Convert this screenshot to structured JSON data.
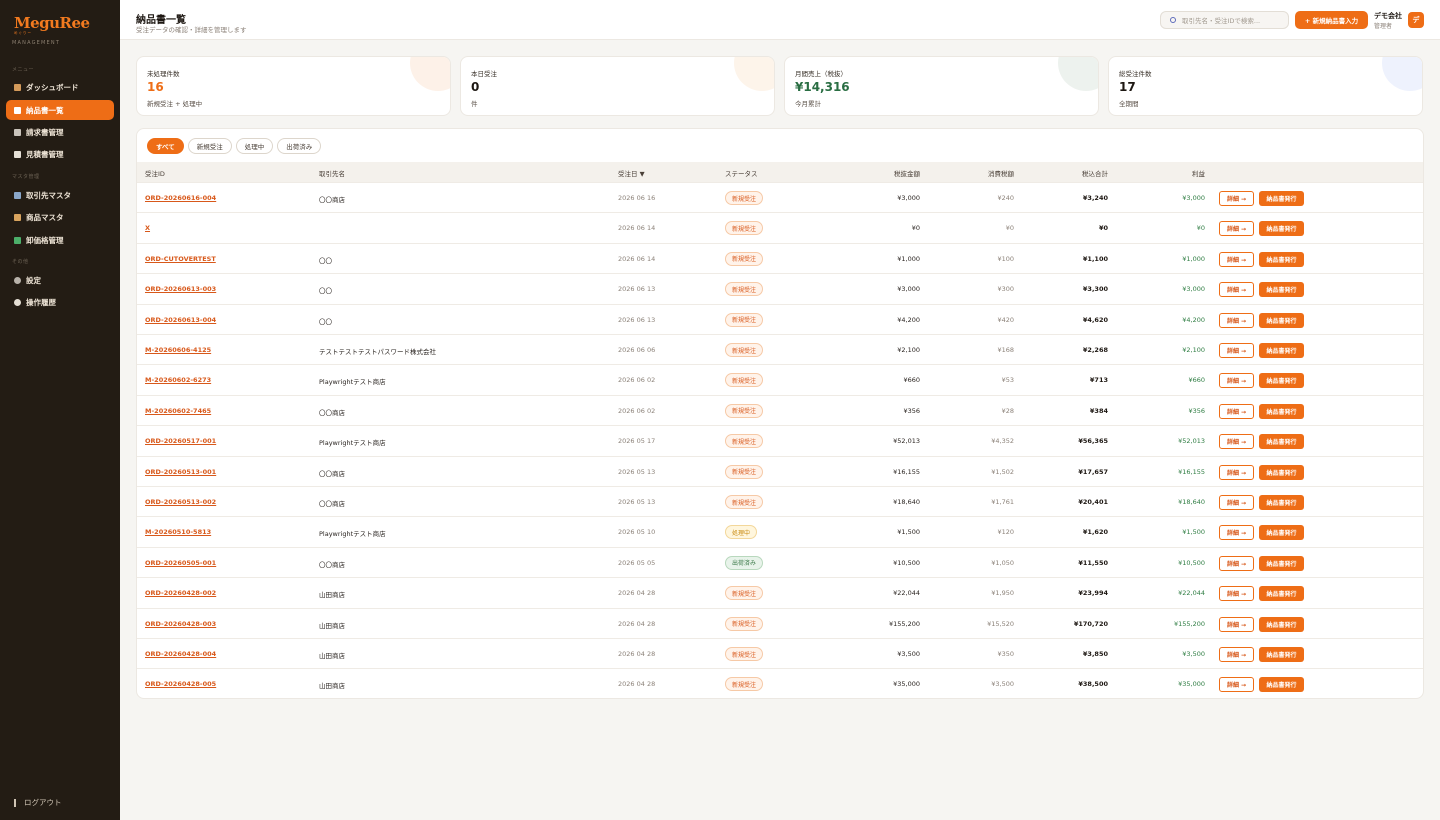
{
  "app": {
    "logo_main": "MeguRee",
    "logo_tagline": "めぐりー",
    "logo_sub": "MANAGEMENT"
  },
  "sidebar": {
    "sections": [
      "メニュー",
      "マスタ管理",
      "その他"
    ],
    "items": [
      {
        "label": "ダッシュボード",
        "icon": "house-icon",
        "active": false
      },
      {
        "label": "納品書一覧",
        "icon": "document-icon",
        "active": true
      },
      {
        "label": "請求書管理",
        "icon": "invoice-icon",
        "active": false
      },
      {
        "label": "見積書管理",
        "icon": "quote-icon",
        "active": false
      },
      {
        "label": "取引先マスタ",
        "icon": "building-icon",
        "active": false
      },
      {
        "label": "商品マスタ",
        "icon": "box-icon",
        "active": false
      },
      {
        "label": "卸価格管理",
        "icon": "price-icon",
        "active": false
      },
      {
        "label": "設定",
        "icon": "gear-icon",
        "active": false
      },
      {
        "label": "操作履歴",
        "icon": "clock-icon",
        "active": false
      }
    ],
    "logout_label": "ログアウト"
  },
  "header": {
    "title": "納品書一覧",
    "subtitle": "受注データの確認・詳細を管理します",
    "search_placeholder": "取引先名・受注IDで検索...",
    "new_button": "+ 新規納品書入力",
    "user_name": "デモ会社",
    "user_role": "管理者",
    "avatar_initial": "デ"
  },
  "stats": [
    {
      "label": "未処理件数",
      "value": "16",
      "sub": "新規受注 + 処理中",
      "color": "#ee6d16",
      "deco": "#fdf1e8"
    },
    {
      "label": "本日受注",
      "value": "0",
      "sub": "件",
      "color": "#1d1712",
      "deco": "#fdf4ea"
    },
    {
      "label": "月間売上（税抜）",
      "value": "¥14,316",
      "sub": "今月累計",
      "color": "#2a6e43",
      "deco": "#edf2ee"
    },
    {
      "label": "総受注件数",
      "value": "17",
      "sub": "全期間",
      "color": "#1d1712",
      "deco": "#eef2fd"
    }
  ],
  "filters": [
    "すべて",
    "新規受注",
    "処理中",
    "出荷済み"
  ],
  "active_filter": "すべて",
  "table": {
    "headers": {
      "id": "受注ID",
      "client": "取引先名",
      "date": "受注日 ▼",
      "status": "ステータス",
      "subtotal": "税抜金額",
      "tax": "消費税額",
      "total": "税込合計",
      "profit": "利益"
    },
    "detail_label": "詳細 →",
    "issue_label": "納品書発行",
    "rows": [
      {
        "id": "ORD-20260616-004",
        "client": "〇〇商店",
        "date": "2026 06 16",
        "status": "新規受注",
        "status_type": "new",
        "subtotal": "¥3,000",
        "tax": "¥240",
        "total": "¥3,240",
        "profit": "¥3,000"
      },
      {
        "id": "X",
        "client": "",
        "date": "2026 06 14",
        "status": "新規受注",
        "status_type": "new",
        "subtotal": "¥0",
        "tax": "¥0",
        "total": "¥0",
        "profit": "¥0"
      },
      {
        "id": "ORD-CUTOVERTEST",
        "client": "〇〇",
        "date": "2026 06 14",
        "status": "新規受注",
        "status_type": "new",
        "subtotal": "¥1,000",
        "tax": "¥100",
        "total": "¥1,100",
        "profit": "¥1,000"
      },
      {
        "id": "ORD-20260613-003",
        "client": "〇〇",
        "date": "2026 06 13",
        "status": "新規受注",
        "status_type": "new",
        "subtotal": "¥3,000",
        "tax": "¥300",
        "total": "¥3,300",
        "profit": "¥3,000"
      },
      {
        "id": "ORD-20260613-004",
        "client": "〇〇",
        "date": "2026 06 13",
        "status": "新規受注",
        "status_type": "new",
        "subtotal": "¥4,200",
        "tax": "¥420",
        "total": "¥4,620",
        "profit": "¥4,200"
      },
      {
        "id": "M-20260606-4125",
        "client": "テストテストテストパスワード株式会社",
        "date": "2026 06 06",
        "status": "新規受注",
        "status_type": "new",
        "subtotal": "¥2,100",
        "tax": "¥168",
        "total": "¥2,268",
        "profit": "¥2,100"
      },
      {
        "id": "M-20260602-6273",
        "client": "Playwrightテスト商店",
        "date": "2026 06 02",
        "status": "新規受注",
        "status_type": "new",
        "subtotal": "¥660",
        "tax": "¥53",
        "total": "¥713",
        "profit": "¥660"
      },
      {
        "id": "M-20260602-7465",
        "client": "〇〇商店",
        "date": "2026 06 02",
        "status": "新規受注",
        "status_type": "new",
        "subtotal": "¥356",
        "tax": "¥28",
        "total": "¥384",
        "profit": "¥356"
      },
      {
        "id": "ORD-20260517-001",
        "client": "Playwrightテスト商店",
        "date": "2026 05 17",
        "status": "新規受注",
        "status_type": "new",
        "subtotal": "¥52,013",
        "tax": "¥4,352",
        "total": "¥56,365",
        "profit": "¥52,013"
      },
      {
        "id": "ORD-20260513-001",
        "client": "〇〇商店",
        "date": "2026 05 13",
        "status": "新規受注",
        "status_type": "new",
        "subtotal": "¥16,155",
        "tax": "¥1,502",
        "total": "¥17,657",
        "profit": "¥16,155"
      },
      {
        "id": "ORD-20260513-002",
        "client": "〇〇商店",
        "date": "2026 05 13",
        "status": "新規受注",
        "status_type": "new",
        "subtotal": "¥18,640",
        "tax": "¥1,761",
        "total": "¥20,401",
        "profit": "¥18,640"
      },
      {
        "id": "M-20260510-5813",
        "client": "Playwrightテスト商店",
        "date": "2026 05 10",
        "status": "処理中",
        "status_type": "proc",
        "subtotal": "¥1,500",
        "tax": "¥120",
        "total": "¥1,620",
        "profit": "¥1,500"
      },
      {
        "id": "ORD-20260505-001",
        "client": "〇〇商店",
        "date": "2026 05 05",
        "status": "出荷済み",
        "status_type": "done",
        "subtotal": "¥10,500",
        "tax": "¥1,050",
        "total": "¥11,550",
        "profit": "¥10,500"
      },
      {
        "id": "ORD-20260428-002",
        "client": "山田商店",
        "date": "2026 04 28",
        "status": "新規受注",
        "status_type": "new",
        "subtotal": "¥22,044",
        "tax": "¥1,950",
        "total": "¥23,994",
        "profit": "¥22,044"
      },
      {
        "id": "ORD-20260428-003",
        "client": "山田商店",
        "date": "2026 04 28",
        "status": "新規受注",
        "status_type": "new",
        "subtotal": "¥155,200",
        "tax": "¥15,520",
        "total": "¥170,720",
        "profit": "¥155,200"
      },
      {
        "id": "ORD-20260428-004",
        "client": "山田商店",
        "date": "2026 04 28",
        "status": "新規受注",
        "status_type": "new",
        "subtotal": "¥3,500",
        "tax": "¥350",
        "total": "¥3,850",
        "profit": "¥3,500"
      },
      {
        "id": "ORD-20260428-005",
        "client": "山田商店",
        "date": "2026 04 28",
        "status": "新規受注",
        "status_type": "new",
        "subtotal": "¥35,000",
        "tax": "¥3,500",
        "total": "¥38,500",
        "profit": "¥35,000"
      }
    ]
  },
  "colors": {
    "accent": "#ee6d16",
    "sidebar_bg": "#231c14",
    "profit": "#2f7d43"
  }
}
